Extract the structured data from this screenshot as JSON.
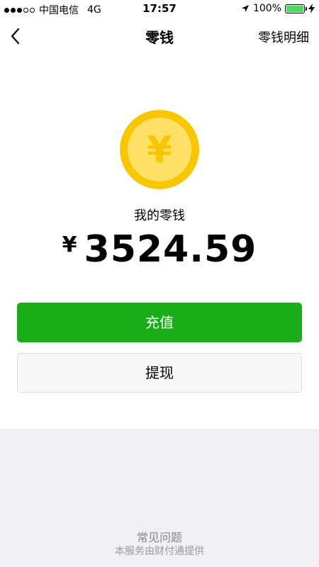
{
  "status_bar": {
    "carrier": "中国电信",
    "network": "4G",
    "time": "17:57",
    "battery": "100%",
    "signal_bars_filled": 3,
    "signal_bars_total": 5,
    "battery_level": 1.0,
    "battery_color": "#4cd964"
  },
  "nav": {
    "title": "零钱",
    "detail_link": "零钱明细"
  },
  "wallet": {
    "label": "我的零钱",
    "currency": "¥",
    "amount": "3524.59",
    "coin_symbol": "¥",
    "coin_outer_color": "#f7c600",
    "coin_inner_color": "#ffe066"
  },
  "actions": {
    "recharge_label": "充值",
    "withdraw_label": "提现",
    "primary_color": "#1aad19"
  },
  "footer": {
    "faq": "常见问题",
    "provider": "本服务由财付通提供"
  }
}
